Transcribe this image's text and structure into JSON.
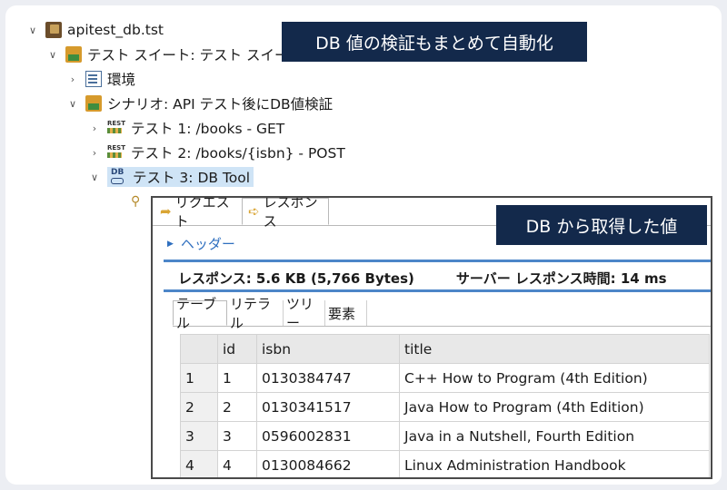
{
  "tree": {
    "project": "apitest_db.tst",
    "suite": "テスト スイート: テスト スイート",
    "env": "環境",
    "scenario": "シナリオ: API テスト後にDB値検証",
    "tests": [
      "テスト 1: /books - GET",
      "テスト 2: /books/{isbn} - POST",
      "テスト 3: DB Tool"
    ]
  },
  "callouts": {
    "top": "DB 値の検証もまとめて自動化",
    "panel": "DB から取得した値"
  },
  "panel": {
    "tabs": [
      "リクエスト",
      "レスポンス"
    ],
    "header_link": "ヘッダー",
    "status_size": "レスポンス: 5.6 KB (5,766 Bytes)",
    "status_time": "サーバー レスポンス時間: 14 ms",
    "subtabs": [
      "テーブル",
      "リテラル",
      "ツリー",
      "要素"
    ]
  },
  "table": {
    "columns": [
      "",
      "id",
      "isbn",
      "title"
    ],
    "rows": [
      [
        "1",
        "1",
        "0130384747",
        "C++ How to Program (4th Edition)"
      ],
      [
        "2",
        "2",
        "0130341517",
        "Java How to Program (4th Edition)"
      ],
      [
        "3",
        "3",
        "0596002831",
        "Java in a Nutshell, Fourth Edition"
      ],
      [
        "4",
        "4",
        "0130084662",
        "Linux Administration Handbook"
      ]
    ]
  },
  "icons": {
    "expanded": "chevron-down-icon",
    "collapsed": "chevron-right-icon",
    "project": "project-icon",
    "suite": "test-suite-icon",
    "env": "environment-icon",
    "rest": "rest-test-icon",
    "db": "db-tool-icon"
  },
  "colors": {
    "callout_bg": "#13294b",
    "selection": "#cfe4f6",
    "link": "#2f6fbf",
    "separator": "#4c86c8"
  }
}
